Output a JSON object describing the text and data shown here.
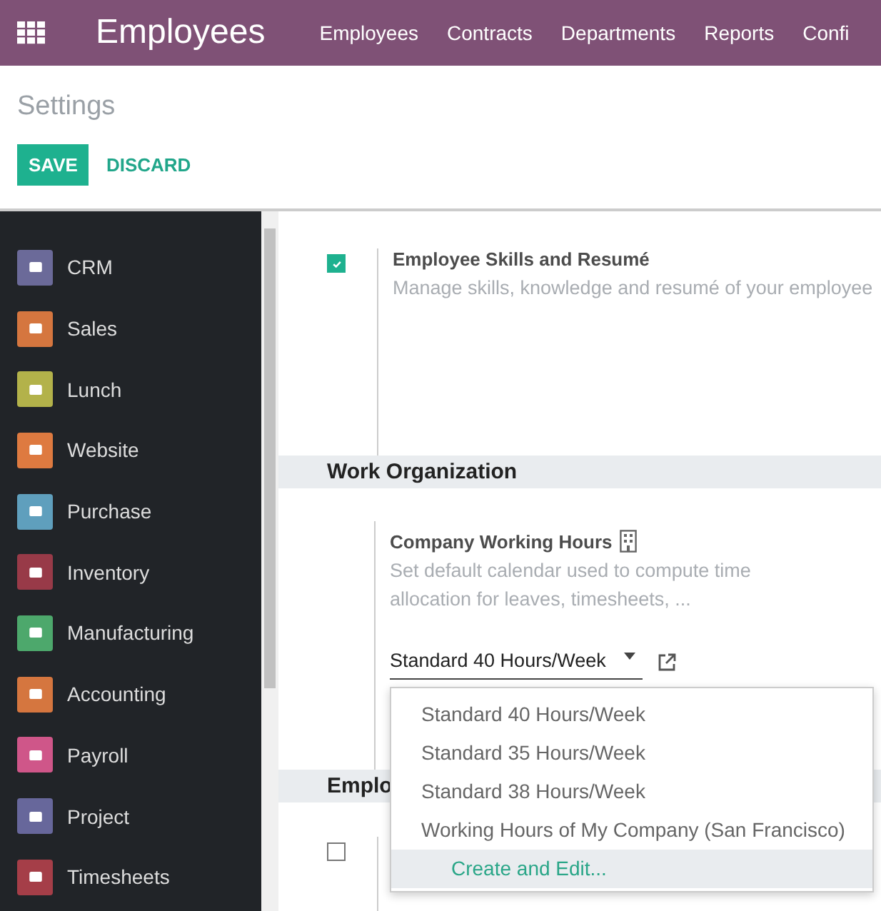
{
  "topbar": {
    "app_title": "Employees",
    "menu": [
      "Employees",
      "Contracts",
      "Departments",
      "Reports",
      "Confi"
    ]
  },
  "control_panel": {
    "title": "Settings",
    "buttons": [
      {
        "label": "SAVE",
        "kind": "primary"
      },
      {
        "label": "DISCARD",
        "kind": "link"
      }
    ]
  },
  "sidebar": {
    "items": [
      {
        "label": "CRM",
        "color": "#6b6a99"
      },
      {
        "label": "Sales",
        "color": "#d5763f"
      },
      {
        "label": "Lunch",
        "color": "#b3b24a"
      },
      {
        "label": "Website",
        "color": "#de7a40"
      },
      {
        "label": "Purchase",
        "color": "#5f9fbd"
      },
      {
        "label": "Inventory",
        "color": "#983a48"
      },
      {
        "label": "Manufacturing",
        "color": "#4da86c"
      },
      {
        "label": "Accounting",
        "color": "#d5763f"
      },
      {
        "label": "Payroll",
        "color": "#cf5689"
      },
      {
        "label": "Project",
        "color": "#67679b"
      },
      {
        "label": "Timesheets",
        "color": "#a53e48"
      }
    ]
  },
  "settings": [
    {
      "kind": "setting",
      "checked": true,
      "title": "Employee Skills and Resumé",
      "description": "Manage skills, knowledge and resumé of your employee"
    },
    {
      "kind": "section",
      "title": "Work Organization"
    },
    {
      "kind": "field_setting",
      "title": "Company Working Hours",
      "description": "Set default calendar used to compute time allocation for leaves, timesheets, ...",
      "value": "Standard 40 Hours/Week",
      "dropdown": [
        {
          "label": "Standard 40 Hours/Week",
          "kind": "option",
          "highlighted": false
        },
        {
          "label": "Standard 35 Hours/Week",
          "kind": "option",
          "highlighted": false
        },
        {
          "label": "Standard 38 Hours/Week",
          "kind": "option",
          "highlighted": false
        },
        {
          "label": "Working Hours of My Company (San Francisco)",
          "kind": "option",
          "highlighted": false
        },
        {
          "label": "Create and Edit...",
          "kind": "action",
          "highlighted": true
        }
      ]
    },
    {
      "kind": "section",
      "title": "Emplo"
    },
    {
      "kind": "setting",
      "checked": false
    }
  ]
}
